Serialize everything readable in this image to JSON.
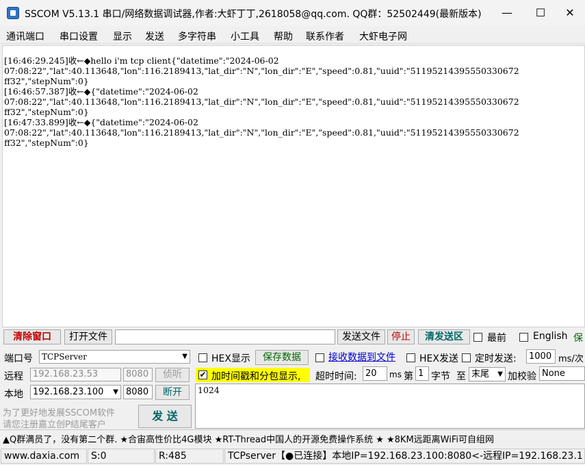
{
  "window": {
    "title": "SSCOM V5.13.1 串口/网络数据调试器,作者:大虾丁丁,2618058@qq.com. QQ群：52502449(最新版本)",
    "minimize_glyph": "—",
    "maximize_glyph": "☐",
    "close_glyph": "✕"
  },
  "menu": [
    "通讯端口",
    "串口设置",
    "显示",
    "发送",
    "多字符串",
    "小工具",
    "帮助",
    "联系作者",
    "大虾电子网"
  ],
  "receive_lines": [
    "[16:46:29.245]收←◆hello i'm tcp client{\"datetime\":\"2024-06-02",
    "07:08:22\",\"lat\":40.113648,\"lon\":116.2189413,\"lat_dir\":\"N\",\"lon_dir\":\"E\",\"speed\":0.81,\"uuid\":\"51195214395550330672",
    "ff32\",\"stepNum\":0}",
    "[16:46:57.387]收←◆{\"datetime\":\"2024-06-02",
    "07:08:22\",\"lat\":40.113648,\"lon\":116.2189413,\"lat_dir\":\"N\",\"lon_dir\":\"E\",\"speed\":0.81,\"uuid\":\"51195214395550330672",
    "ff32\",\"stepNum\":0}",
    "[16:47:33.899]收←◆{\"datetime\":\"2024-06-02",
    "07:08:22\",\"lat\":40.113648,\"lon\":116.2189413,\"lat_dir\":\"N\",\"lon_dir\":\"E\",\"speed\":0.81,\"uuid\":\"51195214395550330672",
    "ff32\",\"stepNum\":0}"
  ],
  "toolbar": {
    "clear_window": "清除窗口",
    "open_file": "打开文件",
    "file_path": "",
    "send_file": "发送文件",
    "stop": "停止",
    "clear_send": "清发送区",
    "topmost": "最前",
    "english": "English",
    "save_cut": "保"
  },
  "port": {
    "port_label": "端口号",
    "port_value": "TCPServer",
    "remote_label": "远程",
    "remote_ip": "192.168.23.53",
    "remote_port": "8080",
    "listen": "侦听",
    "local_label": "本地",
    "local_ip": "192.168.23.100",
    "local_port": "8080",
    "open": "断开",
    "ad_line1": "为了更好地发展SSCOM软件",
    "ad_line2": "请您注册嘉立创P结尾客户",
    "send": "发  送"
  },
  "options": {
    "hex_display": "HEX显示",
    "save_data": "保存数据",
    "recv_to_file": "接收数据到文件",
    "hex_send": "HEX发送",
    "timed_send": "定时发送:",
    "interval": "1000",
    "interval_unit": "ms/次",
    "timestamp": "加时间戳和分包显示,",
    "timeout_label": "超时时间:",
    "timeout_value": "20",
    "timeout_unit": "ms",
    "byte_prefix": "第",
    "byte_index": "1",
    "byte_suffix": "字节",
    "to_label": "至",
    "to_value": "末尾",
    "checksum_label": "加校验",
    "checksum_value": "None"
  },
  "send_text": "1024",
  "ticker": "▲Q群满员了，没有第二个群. ★合宙高性价比4G模块 ★RT-Thread中国人的开源免费操作系统 ★ ★8KM远距离WiFi可自组网",
  "status": {
    "website": "www.daxia.com",
    "sent": "S:0",
    "received": "R:485",
    "connection": "TCPserver【●已连接】本地IP=192.168.23.100:8080<-远程IP=192.168.23.1"
  },
  "colors": {
    "clear_red": "#c00000",
    "blue_text": "#0000cc",
    "green_text": "#006600",
    "highlight_yellow": "#ffff00"
  }
}
